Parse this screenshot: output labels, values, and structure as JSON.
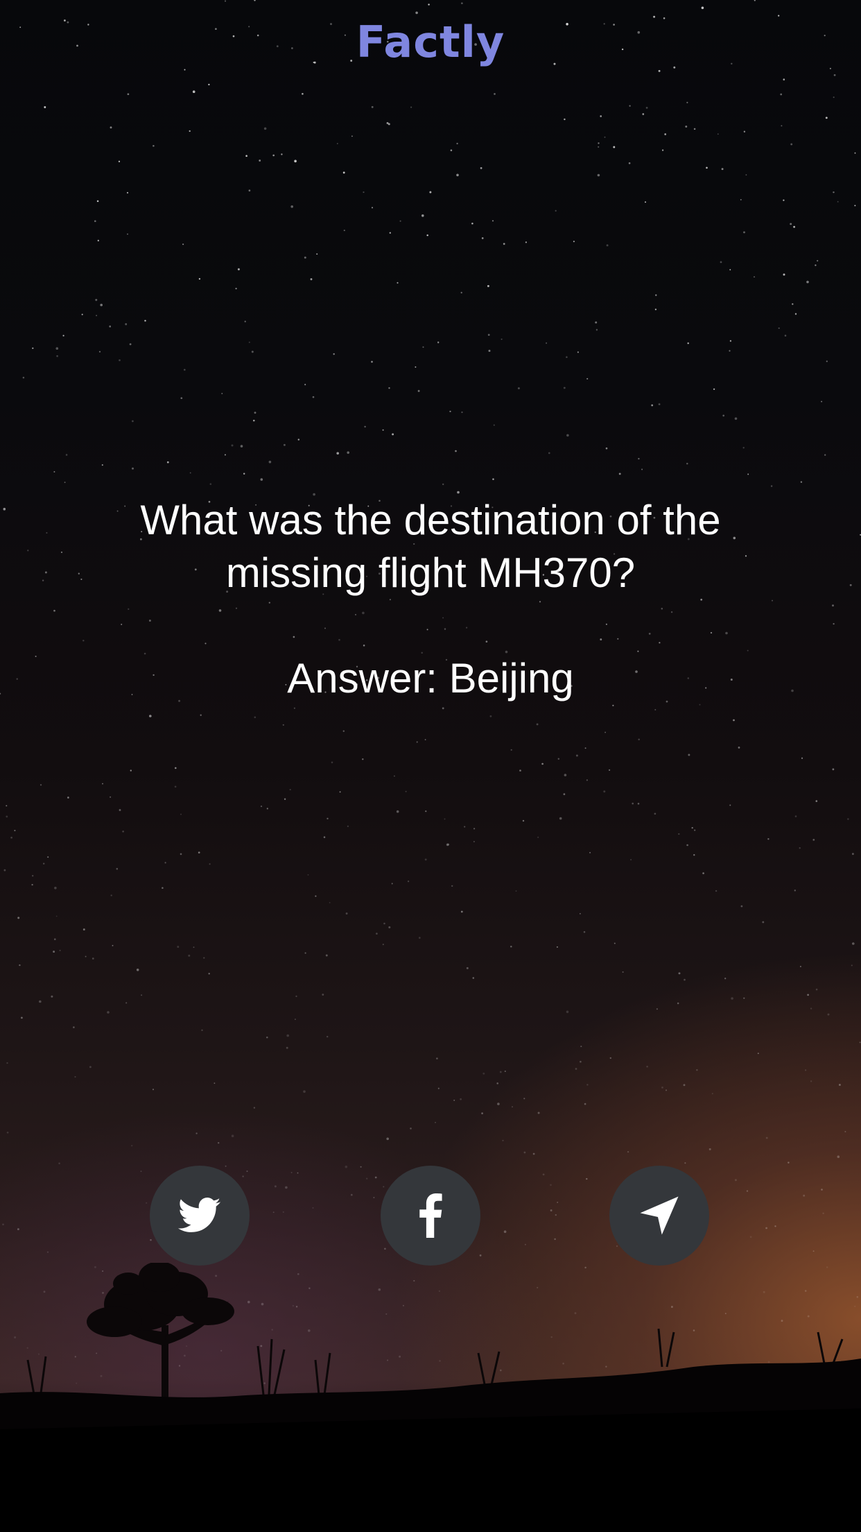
{
  "app": {
    "title": "Factly"
  },
  "fact": {
    "question": "What was the destination of the missing flight MH370?",
    "answer": "Answer: Beijing"
  },
  "share": {
    "buttons": [
      {
        "icon": "twitter-icon"
      },
      {
        "icon": "facebook-icon"
      },
      {
        "icon": "send-icon"
      }
    ]
  },
  "colors": {
    "title": "#7f86e0",
    "button_bg": "#34373b",
    "text": "#ffffff"
  }
}
